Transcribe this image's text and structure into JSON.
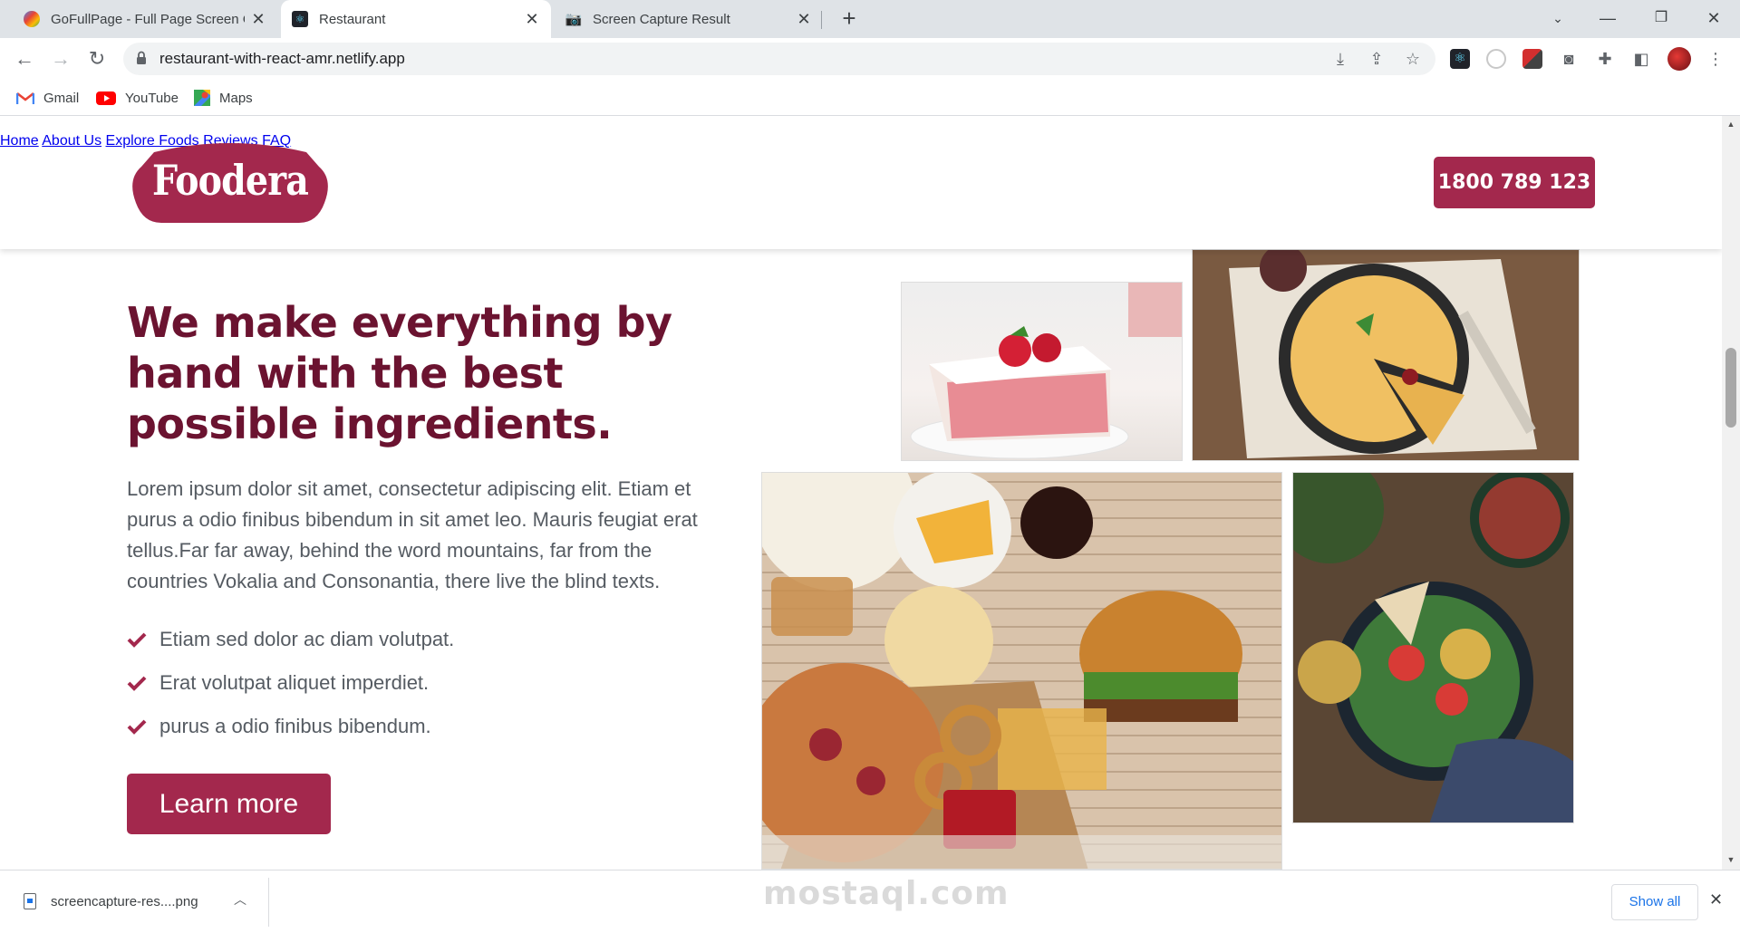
{
  "browser": {
    "tabs": [
      {
        "title": "GoFullPage - Full Page Screen Ca",
        "active": false
      },
      {
        "title": "Restaurant",
        "active": true
      },
      {
        "title": "Screen Capture Result",
        "active": false
      }
    ],
    "new_tab": "+",
    "url": "restaurant-with-react-amr.netlify.app",
    "bookmarks": [
      {
        "label": "Gmail"
      },
      {
        "label": "YouTube"
      },
      {
        "label": "Maps"
      }
    ]
  },
  "site": {
    "logo_text": "Foodera",
    "nav": [
      "Home",
      "About Us",
      "Explore Foods",
      "Reviews",
      "FAQ"
    ],
    "phone": "1800 789 123"
  },
  "hero": {
    "title": "We make everything by hand with the best possible ingredients.",
    "paragraph": "Lorem ipsum dolor sit amet, consectetur adipiscing elit. Etiam et purus a odio finibus bibendum in sit amet leo. Mauris feugiat erat tellus.Far far away, behind the word mountains, far from the countries Vokalia and Consonantia, there live the blind texts.",
    "checklist": [
      "Etiam sed dolor ac diam volutpat.",
      "Erat volutpat aliquet imperdiet.",
      "purus a odio finibus bibendum."
    ],
    "button": "Learn more"
  },
  "download": {
    "filename": "screencapture-res....png",
    "show_all": "Show all"
  },
  "watermark": "mostaql.com",
  "colors": {
    "brand": "#a3284d",
    "heading": "#6b1330",
    "body_text": "#555b62"
  }
}
